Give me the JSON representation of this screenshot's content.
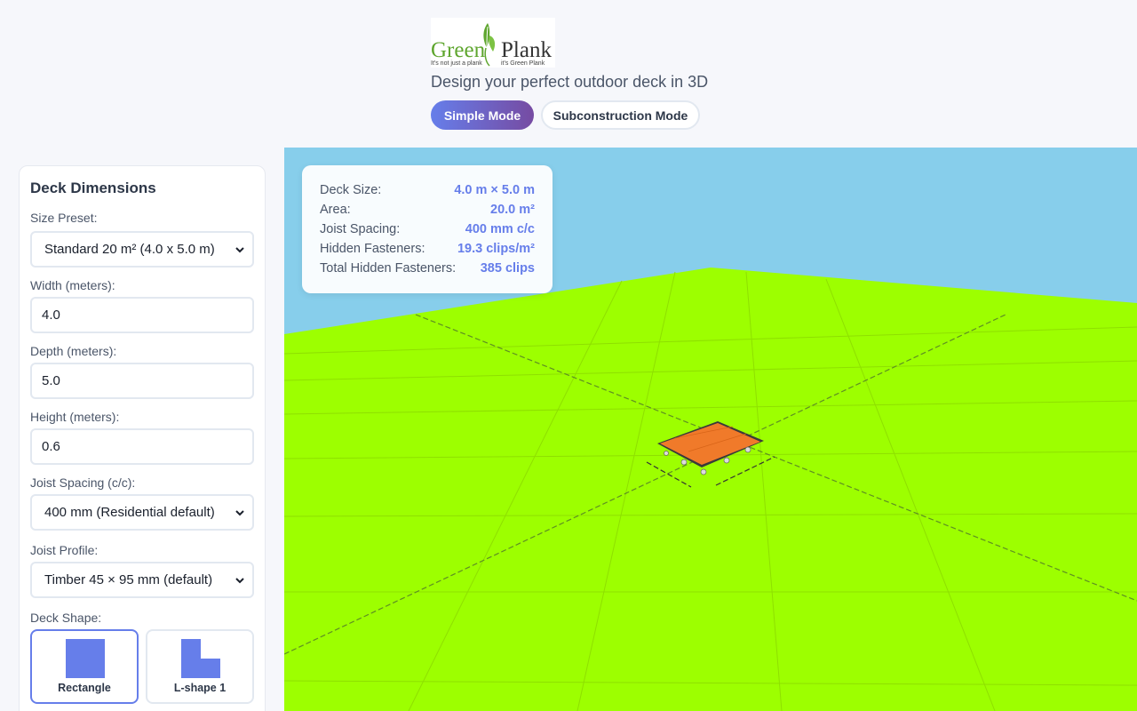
{
  "header": {
    "logo": {
      "brand_green": "Green",
      "brand_plank": "Plank",
      "slogan_left": "It's not just a plank",
      "slogan_right": "it's Green Plank",
      "icon": "leaf-icon"
    },
    "tagline": "Design your perfect outdoor deck in 3D",
    "modes": [
      {
        "label": "Simple Mode",
        "active": true
      },
      {
        "label": "Subconstruction Mode",
        "active": false
      }
    ]
  },
  "sidebar": {
    "title": "Deck Dimensions",
    "size_preset": {
      "label": "Size Preset:",
      "value": "Standard 20 m² (4.0 x 5.0 m)"
    },
    "width": {
      "label": "Width (meters):",
      "value": "4.0"
    },
    "depth": {
      "label": "Depth (meters):",
      "value": "5.0"
    },
    "height": {
      "label": "Height (meters):",
      "value": "0.6"
    },
    "joist_spacing": {
      "label": "Joist Spacing (c/c):",
      "value": "400 mm (Residential default)"
    },
    "joist_profile": {
      "label": "Joist Profile:",
      "value": "Timber 45 × 95 mm (default)"
    },
    "deck_shape": {
      "label": "Deck Shape:",
      "options": [
        {
          "label": "Rectangle",
          "active": true,
          "icon": "rectangle-shape-icon"
        },
        {
          "label": "L-shape 1",
          "active": false,
          "icon": "l-shape-icon"
        }
      ]
    }
  },
  "info_panel": {
    "rows": [
      {
        "key": "Deck Size:",
        "value": "4.0 m × 5.0 m"
      },
      {
        "key": "Area:",
        "value": "20.0 m²"
      },
      {
        "key": "Joist Spacing:",
        "value": "400 mm c/c"
      },
      {
        "key": "Hidden Fasteners:",
        "value": "19.3 clips/m²"
      },
      {
        "key": "Total Hidden Fasteners:",
        "value": "385 clips"
      }
    ]
  },
  "colors": {
    "accent": "#667eea",
    "accent_end": "#764ba2",
    "sky": "#87ceeb",
    "grass": "#9dff00",
    "deck": "#f07a2a",
    "brand_green": "#5fa62f"
  }
}
